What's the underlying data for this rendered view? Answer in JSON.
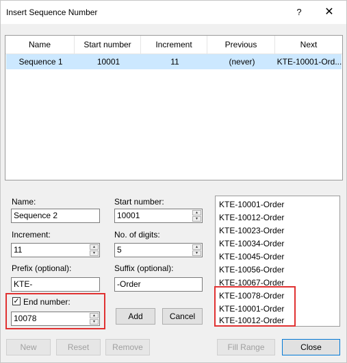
{
  "window": {
    "title": "Insert Sequence Number",
    "help_glyph": "?",
    "close_glyph": "✕"
  },
  "table": {
    "headers": [
      "Name",
      "Start number",
      "Increment",
      "Previous",
      "Next"
    ],
    "rows": [
      [
        "Sequence 1",
        "10001",
        "11",
        "(never)",
        "KTE-10001-Ord..."
      ]
    ]
  },
  "form": {
    "name_label": "Name:",
    "name_value": "Sequence 2",
    "start_label": "Start number:",
    "start_value": "10001",
    "increment_label": "Increment:",
    "increment_value": "11",
    "digits_label": "No. of digits:",
    "digits_value": "5",
    "prefix_label": "Prefix (optional):",
    "prefix_value": "KTE-",
    "suffix_label": "Suffix (optional):",
    "suffix_value": "-Order",
    "end_label": "End number:",
    "end_checked": true,
    "end_value": "10078",
    "add_label": "Add",
    "cancel_label": "Cancel"
  },
  "preview": {
    "items": [
      "KTE-10001-Order",
      "KTE-10012-Order",
      "KTE-10023-Order",
      "KTE-10034-Order",
      "KTE-10045-Order",
      "KTE-10056-Order",
      "KTE-10067-Order",
      "KTE-10078-Order",
      "KTE-10001-Order",
      "KTE-10012-Order"
    ]
  },
  "footer": {
    "new_label": "New",
    "reset_label": "Reset",
    "remove_label": "Remove",
    "fill_range_label": "Fill Range",
    "close_label": "Close"
  },
  "colors": {
    "highlight_box": "#e03030",
    "selected_row": "#cce8ff"
  }
}
